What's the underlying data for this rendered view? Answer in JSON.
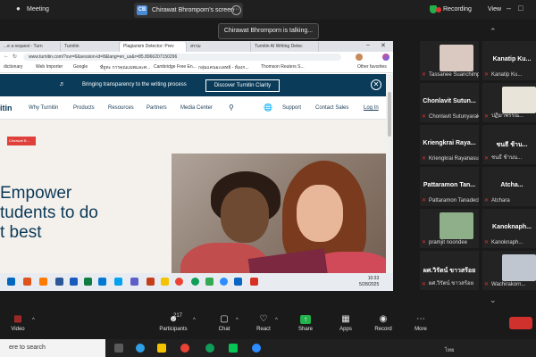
{
  "zoom_top": {
    "meeting_label": "Meeting",
    "share_badge": "CB",
    "share_title": "Chirawat Bhromporn's screen",
    "recording_label": "Recording",
    "view_label": "View"
  },
  "talking_banner": "Chirawat Bhromporn is talking...",
  "browser": {
    "tabs": [
      "...e a request - Turn",
      "Turnitin",
      "Plagiarism Detector: Prev",
      "สรรม",
      "Turnitin AI Writing Detec"
    ],
    "url": "www.turnitin.com/?svr=6&session-id=8&lang=en_us&r=85.8966207150296",
    "bookmarks": [
      "dictionary",
      "Web Importer",
      "Google",
      "ที่ยูทะ การคุณแมพและศ...",
      "Cambridge Free En...",
      "กลุ่มแคนอะเดทย์ - ห้องก...",
      "Thomson Reuters S...",
      "Other favorites"
    ]
  },
  "site": {
    "banner_text": "Bringing transparency to the writing process",
    "banner_button": "Discover Turnitin Clarity",
    "brand": "itin",
    "nav": [
      "Why Turnitin",
      "Products",
      "Resources",
      "Partners",
      "Media Center",
      "Support",
      "Contact Sales",
      "Log In"
    ],
    "hero_tag": "Chirawat B...",
    "hero_line1": "Empower",
    "hero_line2": "tudents to do",
    "hero_line3": "t best"
  },
  "inner_taskbar": {
    "time": "10:33",
    "date": "5/28/2025"
  },
  "gallery": [
    {
      "name": "",
      "sub": "Tassanee Suanchimpl...",
      "has_avatar": true,
      "avatar_color": "#d9c9c0"
    },
    {
      "name": "Kanatip Ku...",
      "sub": "Kanatip Ku...",
      "has_avatar": false
    },
    {
      "name": "Chonlavit Sutun...",
      "sub": "Chonlavit Sutunyarak",
      "has_avatar": false
    },
    {
      "name": "",
      "sub": "ปฏิมาพรรณ...",
      "has_avatar": true,
      "avatar_color": "#e9e4da"
    },
    {
      "name": "Kriengkrai Raya...",
      "sub": "Kriengkrai Rayanasuk",
      "has_avatar": false
    },
    {
      "name": "ชนธี ช้าน...",
      "sub": "ชนธี ช้านน...",
      "has_avatar": false
    },
    {
      "name": "Pattaramon Tan...",
      "sub": "Pattaramon Tanadecha",
      "has_avatar": false
    },
    {
      "name": "Atcha...",
      "sub": "Atchara",
      "has_avatar": false
    },
    {
      "name": "",
      "sub": "pramjit noondee",
      "has_avatar": true,
      "avatar_color": "#8fae8a"
    },
    {
      "name": "Kanoknaph...",
      "sub": "Kanoknaph...",
      "has_avatar": false
    },
    {
      "name": "ผศ.วิรัตน์ ขาวสร้อย",
      "sub": "ผศ.วิรัตน์ ขาวสร้อย",
      "has_avatar": false
    },
    {
      "name": "",
      "sub": "Wachirakorn...",
      "has_avatar": true,
      "avatar_color": "#bfc6cf"
    }
  ],
  "toolbar": {
    "video": "Video",
    "participants": "Participants",
    "participants_count": "217",
    "chat": "Chat",
    "react": "React",
    "share": "Share",
    "apps": "Apps",
    "record": "Record",
    "more": "More"
  },
  "windows": {
    "search_text": "ere to search",
    "lang": "ไทย"
  }
}
